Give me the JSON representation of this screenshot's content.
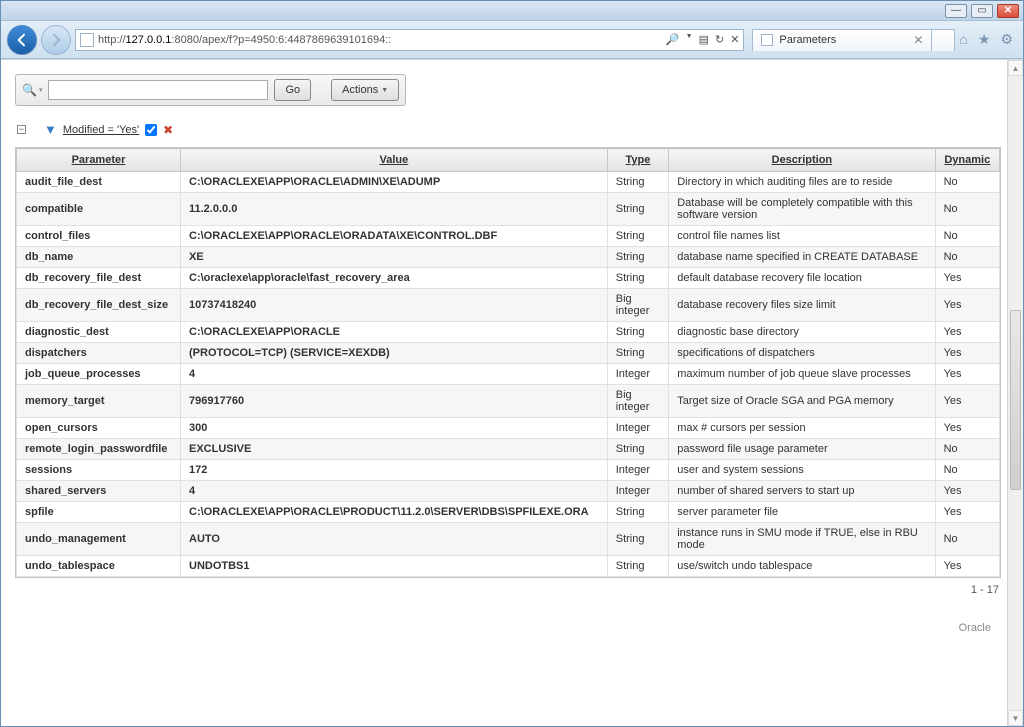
{
  "browser": {
    "url_prefix": "http://",
    "url_host": "127.0.0.1",
    "url_port": ":8080",
    "url_rest": "/apex/f?p=4950:6:4487869639101694::",
    "tab_title": "Parameters"
  },
  "toolbar": {
    "go_label": "Go",
    "actions_label": "Actions"
  },
  "filter": {
    "label": "Modified = 'Yes'"
  },
  "columns": {
    "parameter": "Parameter",
    "value": "Value",
    "type": "Type",
    "description": "Description",
    "dynamic": "Dynamic"
  },
  "rows": [
    {
      "param": "audit_file_dest",
      "value": "C:\\ORACLEXE\\APP\\ORACLE\\ADMIN\\XE\\ADUMP",
      "type": "String",
      "desc": "Directory in which auditing files are to reside",
      "dyn": "No"
    },
    {
      "param": "compatible",
      "value": "11.2.0.0.0",
      "type": "String",
      "desc": "Database will be completely compatible with this software version",
      "dyn": "No"
    },
    {
      "param": "control_files",
      "value": "C:\\ORACLEXE\\APP\\ORACLE\\ORADATA\\XE\\CONTROL.DBF",
      "type": "String",
      "desc": "control file names list",
      "dyn": "No"
    },
    {
      "param": "db_name",
      "value": "XE",
      "type": "String",
      "desc": "database name specified in CREATE DATABASE",
      "dyn": "No"
    },
    {
      "param": "db_recovery_file_dest",
      "value": "C:\\oraclexe\\app\\oracle\\fast_recovery_area",
      "type": "String",
      "desc": "default database recovery file location",
      "dyn": "Yes"
    },
    {
      "param": "db_recovery_file_dest_size",
      "value": "10737418240",
      "type": "Big integer",
      "desc": "database recovery files size limit",
      "dyn": "Yes"
    },
    {
      "param": "diagnostic_dest",
      "value": "C:\\ORACLEXE\\APP\\ORACLE",
      "type": "String",
      "desc": "diagnostic base directory",
      "dyn": "Yes"
    },
    {
      "param": "dispatchers",
      "value": "(PROTOCOL=TCP) (SERVICE=XEXDB)",
      "type": "String",
      "desc": "specifications of dispatchers",
      "dyn": "Yes"
    },
    {
      "param": "job_queue_processes",
      "value": "4",
      "type": "Integer",
      "desc": "maximum number of job queue slave processes",
      "dyn": "Yes"
    },
    {
      "param": "memory_target",
      "value": "796917760",
      "type": "Big integer",
      "desc": "Target size of Oracle SGA and PGA memory",
      "dyn": "Yes"
    },
    {
      "param": "open_cursors",
      "value": "300",
      "type": "Integer",
      "desc": "max # cursors per session",
      "dyn": "Yes"
    },
    {
      "param": "remote_login_passwordfile",
      "value": "EXCLUSIVE",
      "type": "String",
      "desc": "password file usage parameter",
      "dyn": "No"
    },
    {
      "param": "sessions",
      "value": "172",
      "type": "Integer",
      "desc": "user and system sessions",
      "dyn": "No"
    },
    {
      "param": "shared_servers",
      "value": "4",
      "type": "Integer",
      "desc": "number of shared servers to start up",
      "dyn": "Yes"
    },
    {
      "param": "spfile",
      "value": "C:\\ORACLEXE\\APP\\ORACLE\\PRODUCT\\11.2.0\\SERVER\\DBS\\SPFILEXE.ORA",
      "type": "String",
      "desc": "server parameter file",
      "dyn": "Yes"
    },
    {
      "param": "undo_management",
      "value": "AUTO",
      "type": "String",
      "desc": "instance runs in SMU mode if TRUE, else in RBU mode",
      "dyn": "No"
    },
    {
      "param": "undo_tablespace",
      "value": "UNDOTBS1",
      "type": "String",
      "desc": "use/switch undo tablespace",
      "dyn": "Yes"
    }
  ],
  "pagination": "1 - 17",
  "footer": "Oracle"
}
